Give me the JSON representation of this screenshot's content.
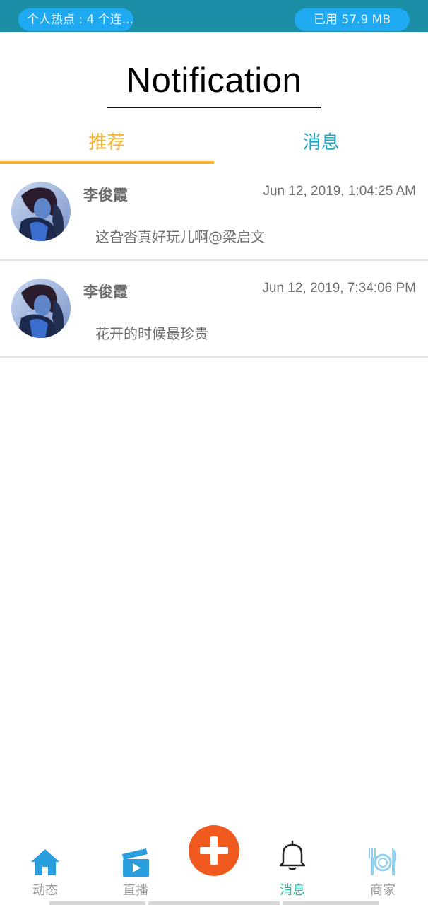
{
  "status_bar": {
    "hotspot_text": "个人热点 : 4 个连...",
    "memory_text": "已用 57.9 MB"
  },
  "page": {
    "title": "Notification"
  },
  "tabs": [
    {
      "label": "推荐",
      "active": true
    },
    {
      "label": "消息",
      "active": false
    }
  ],
  "notifications": [
    {
      "name": "李俊霞",
      "time": "Jun 12, 2019, 1:04:25 AM",
      "message": "这旮沓真好玩儿啊@梁启文"
    },
    {
      "name": "李俊霞",
      "time": "Jun 12, 2019, 7:34:06 PM",
      "message": "花开的时候最珍贵"
    }
  ],
  "bottom_nav": {
    "items": [
      {
        "label": "动态",
        "icon": "home-icon",
        "active": false
      },
      {
        "label": "直播",
        "icon": "clapperboard-icon",
        "active": false
      },
      {
        "label": "消息",
        "icon": "bell-icon",
        "active": true
      },
      {
        "label": "商家",
        "icon": "dining-icon",
        "active": false
      }
    ],
    "fab_icon": "plus-icon"
  },
  "colors": {
    "status_bar": "#1a8fa6",
    "pill": "#1fa9f0",
    "tab_active": "#f4b332",
    "tab_inactive": "#1fa9c6",
    "nav_active": "#27b8a0",
    "fab": "#f15a1e"
  }
}
